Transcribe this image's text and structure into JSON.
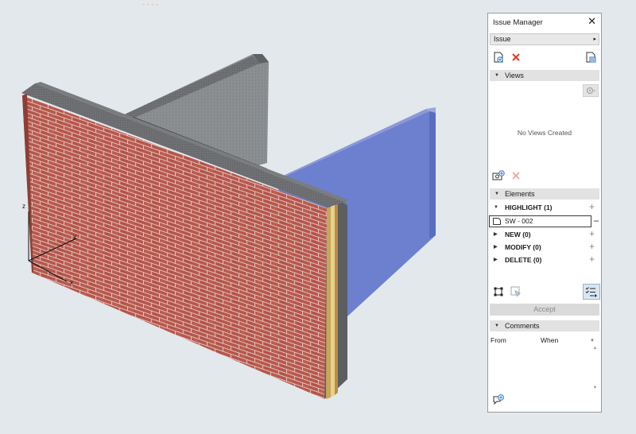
{
  "canvas": {
    "marker": "----",
    "axes": {
      "z": "z",
      "y": "y",
      "x": "x"
    }
  },
  "panel": {
    "title": "Issue Manager",
    "close_glyph": "✕",
    "issue_dropdown": {
      "value": "Issue",
      "arrow": "▸"
    },
    "toolbar_icons": [
      "new-issue-icon",
      "delete-issue-icon",
      "issue-settings-icon"
    ],
    "views": {
      "label": "Views",
      "empty_text": "No Views Created",
      "icons": [
        "view-settings-icon",
        "add-view-icon",
        "delete-view-icon"
      ]
    },
    "elements": {
      "label": "Elements",
      "groups": [
        {
          "label": "HIGHLIGHT (1)",
          "expanded": true
        },
        {
          "label": "NEW (0)",
          "expanded": false
        },
        {
          "label": "MODIFY (0)",
          "expanded": false
        },
        {
          "label": "DELETE (0)",
          "expanded": false
        }
      ],
      "selected_item": "SW - 002",
      "plus_glyph": "+",
      "minus_glyph": "−",
      "tool_icons": [
        "select-elements-icon",
        "highlight-mode-icon",
        "checklist-icon"
      ]
    },
    "accept_label": "Accept",
    "comments": {
      "label": "Comments",
      "col_from": "From",
      "col_when": "When",
      "sort_glyph": "▼",
      "add_icon": "add-comment-icon"
    }
  }
}
